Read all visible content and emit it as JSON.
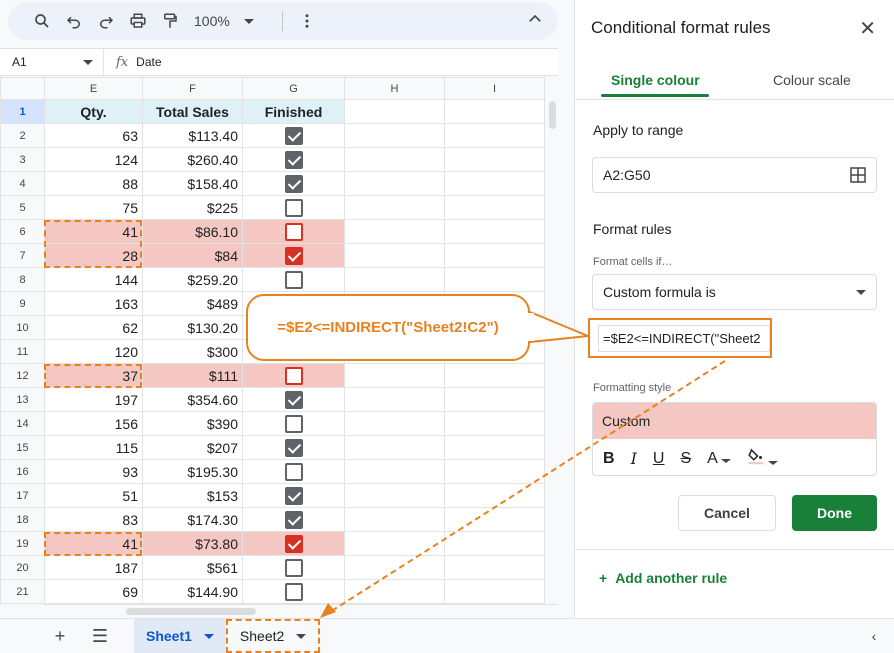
{
  "toolbar": {
    "zoom": "100%"
  },
  "formula_bar": {
    "cell_ref": "A1",
    "fx": "fx",
    "content": "Date"
  },
  "columns": [
    "E",
    "F",
    "G",
    "H",
    "I"
  ],
  "rows": [
    {
      "n": "1",
      "e": "Qty.",
      "f": "Total Sales",
      "g": "Finished",
      "header": true
    },
    {
      "n": "2",
      "e": "63",
      "f": "$113.40",
      "checked": true
    },
    {
      "n": "3",
      "e": "124",
      "f": "$260.40",
      "checked": true
    },
    {
      "n": "4",
      "e": "88",
      "f": "$158.40",
      "checked": true
    },
    {
      "n": "5",
      "e": "75",
      "f": "$225",
      "checked": false
    },
    {
      "n": "6",
      "e": "41",
      "f": "$86.10",
      "checked": false,
      "hl": true
    },
    {
      "n": "7",
      "e": "28",
      "f": "$84",
      "checked": true,
      "hl": true
    },
    {
      "n": "8",
      "e": "144",
      "f": "$259.20",
      "checked": false
    },
    {
      "n": "9",
      "e": "163",
      "f": "$489",
      "checked": false
    },
    {
      "n": "10",
      "e": "62",
      "f": "$130.20",
      "checked": false
    },
    {
      "n": "11",
      "e": "120",
      "f": "$300",
      "checked": false
    },
    {
      "n": "12",
      "e": "37",
      "f": "$111",
      "checked": false,
      "hl": true
    },
    {
      "n": "13",
      "e": "197",
      "f": "$354.60",
      "checked": true
    },
    {
      "n": "14",
      "e": "156",
      "f": "$390",
      "checked": false
    },
    {
      "n": "15",
      "e": "115",
      "f": "$207",
      "checked": true
    },
    {
      "n": "16",
      "e": "93",
      "f": "$195.30",
      "checked": false
    },
    {
      "n": "17",
      "e": "51",
      "f": "$153",
      "checked": true
    },
    {
      "n": "18",
      "e": "83",
      "f": "$174.30",
      "checked": true
    },
    {
      "n": "19",
      "e": "41",
      "f": "$73.80",
      "checked": true,
      "hl": true
    },
    {
      "n": "20",
      "e": "187",
      "f": "$561",
      "checked": false
    },
    {
      "n": "21",
      "e": "69",
      "f": "$144.90",
      "checked": false
    }
  ],
  "sheets": {
    "sheet1": "Sheet1",
    "sheet2": "Sheet2"
  },
  "panel": {
    "title": "Conditional format rules",
    "tab_single": "Single colour",
    "tab_scale": "Colour scale",
    "apply_label": "Apply to range",
    "range_value": "A2:G50",
    "format_rules_label": "Format rules",
    "format_cells_if": "Format cells if…",
    "condition": "Custom formula is",
    "formula_value": "=$E2<=INDIRECT(\"Sheet2",
    "formatting_style_label": "Formatting style",
    "style_preview": "Custom",
    "cancel": "Cancel",
    "done": "Done",
    "add_rule": "Add another rule"
  },
  "callout": {
    "formula": "=$E2<=INDIRECT(\"Sheet2!C2\")"
  },
  "colors": {
    "accent": "#e8821e",
    "green": "#188038",
    "highlight": "#f4c7c3"
  }
}
